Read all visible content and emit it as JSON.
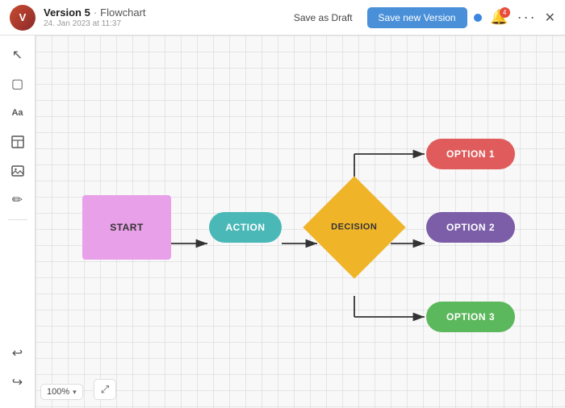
{
  "header": {
    "version": "Version 5",
    "separator": "·",
    "title": "Flowchart",
    "date": "24. Jan 2023 at 11:37",
    "save_draft_label": "Save as Draft",
    "save_version_label": "Save new Version",
    "notification_count": "4",
    "close_label": "✕"
  },
  "toolbar": {
    "tools": [
      {
        "name": "cursor",
        "icon": "↖",
        "label": "Select"
      },
      {
        "name": "rectangle",
        "icon": "▢",
        "label": "Rectangle"
      },
      {
        "name": "text",
        "icon": "Aa",
        "label": "Text"
      },
      {
        "name": "table",
        "icon": "⊞",
        "label": "Table"
      },
      {
        "name": "image",
        "icon": "🖼",
        "label": "Image"
      },
      {
        "name": "pen",
        "icon": "✏",
        "label": "Draw"
      }
    ],
    "undo_icon": "↩",
    "redo_icon": "↪",
    "zoom_level": "100%",
    "expand_icon": "⤢"
  },
  "flowchart": {
    "nodes": {
      "start": "START",
      "action": "ACTION",
      "decision": "DECISION",
      "option1": "OPTION 1",
      "option2": "OPTION 2",
      "option3": "OPTION 3"
    },
    "colors": {
      "start": "#e8a0e8",
      "action": "#4bb8b8",
      "decision": "#f0b429",
      "option1": "#e05c5c",
      "option2": "#7b5ea7",
      "option3": "#5cb85c"
    }
  }
}
